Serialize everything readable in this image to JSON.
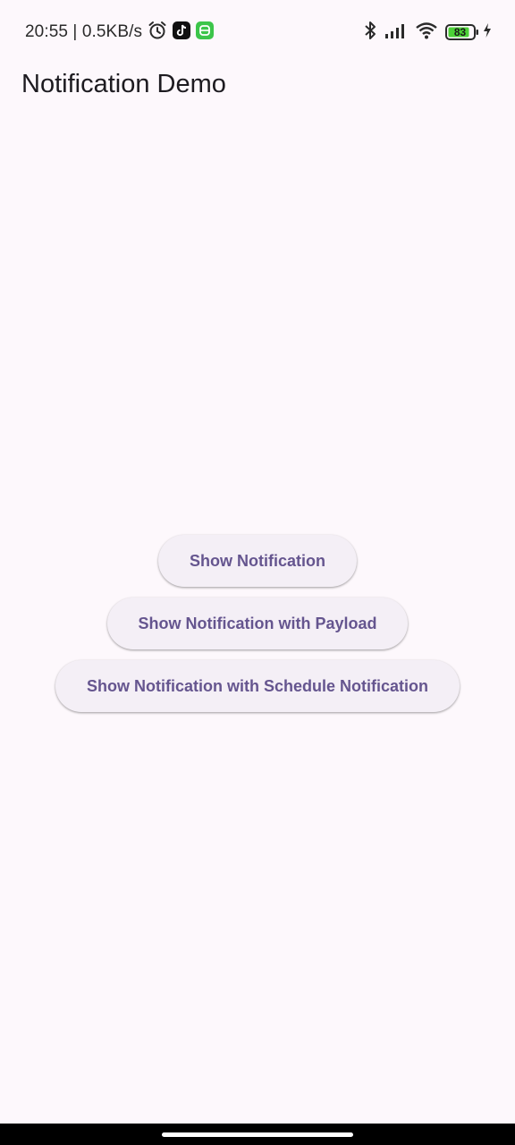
{
  "status_bar": {
    "time_speed": "20:55 | 0.5KB/s",
    "battery_level": "83",
    "icons": [
      "alarm-icon",
      "tiktok-icon",
      "green-app-icon",
      "bluetooth-icon",
      "signal-icon",
      "wifi-icon",
      "battery-icon",
      "charging-icon"
    ],
    "battery_color": "#4cd137"
  },
  "app_bar": {
    "title": "Notification Demo"
  },
  "buttons": {
    "show_notification": "Show Notification",
    "show_with_payload": "Show Notification with Payload",
    "show_with_schedule": "Show Notification with Schedule Notification"
  },
  "colors": {
    "background": "#fdf8fc",
    "button_bg": "#f4eff6",
    "button_text": "#65558f",
    "title_text": "#1d1b20"
  }
}
